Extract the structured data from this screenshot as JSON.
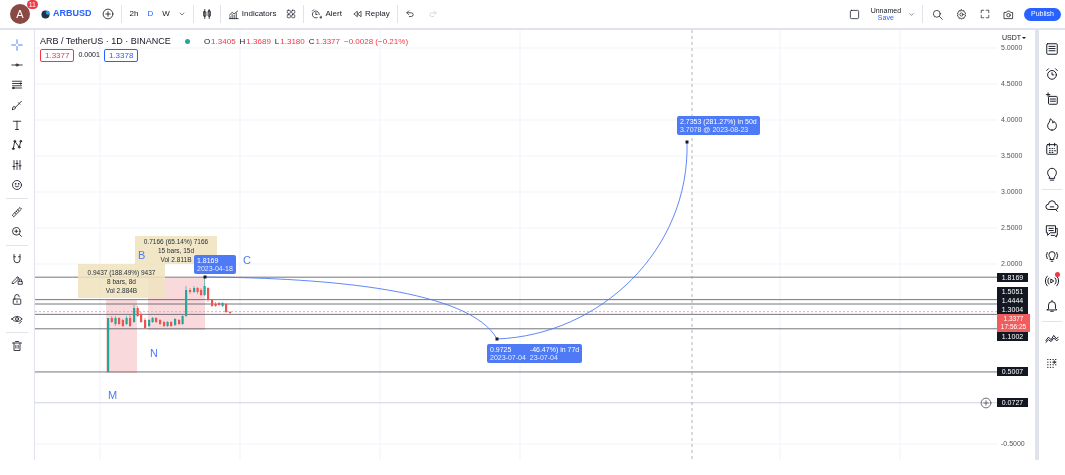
{
  "header": {
    "avatar": "A",
    "avatar_badge": "11",
    "symbol": "ARBUSD",
    "intervals": [
      {
        "label": "2h",
        "selected": false
      },
      {
        "label": "D",
        "selected": true
      },
      {
        "label": "W",
        "selected": false
      }
    ],
    "indicators": "Indicators",
    "alert": "Alert",
    "replay": "Replay",
    "layout_name": "Unnamed",
    "save": "Save",
    "publish": "Publish"
  },
  "left_toolbar": [
    {
      "selected": true
    },
    {
      "selected": false
    },
    {
      "selected": false
    },
    {
      "selected": false
    },
    {
      "selected": false
    },
    {
      "selected": false
    },
    {
      "selected": false
    },
    {
      "selected": false
    },
    {
      "selected": false
    },
    {
      "selected": false
    },
    {
      "selected": false
    },
    {
      "selected": false
    },
    {
      "selected": false
    },
    {
      "selected": false
    },
    {
      "selected": false
    }
  ],
  "legend": {
    "title": "ARB / TetherUS · 1D · BINANCE",
    "ohlc": [
      {
        "key": "O",
        "value": "1.3405"
      },
      {
        "key": "H",
        "value": "1.3689"
      },
      {
        "key": "L",
        "value": "1.3180"
      },
      {
        "key": "C",
        "value": "1.3377"
      }
    ],
    "change": "−0.0028 (−0.21%)",
    "sell": "1.3377",
    "spread": "0.0001",
    "buy": "1.3378"
  },
  "chart": {
    "range_boxes": [
      {
        "lines": [
          "0.9437 (188.49%) 9437",
          "8 bars, 8d",
          "Vol 2.884B"
        ]
      },
      {
        "lines": [
          "0.7166 (65.14%) 7166",
          "15 bars, 15d",
          "Vol 2.811B"
        ]
      }
    ],
    "points": [
      "B",
      "C",
      "N",
      "M"
    ],
    "callouts": [
      {
        "kind": "single",
        "title": "1.8169",
        "subtitle": "2023-04-18"
      },
      {
        "kind": "single",
        "title": "2.7353 (281.27%) in 50d",
        "subtitle": "3.7078 @ 2023-08-23"
      },
      {
        "kind": "split",
        "columns": [
          {
            "title": "0.9725",
            "subtitle": "2023-07-04"
          },
          {
            "title": "-46.47%) in 77d",
            "subtitle": "23-07-04"
          }
        ]
      }
    ]
  },
  "price_axis": {
    "currency": "USDT",
    "ticks": [
      "5.0000",
      "4.5000",
      "4.0000",
      "3.5000",
      "3.0000",
      "2.5000",
      "2.0000",
      "-0.5000"
    ],
    "levels": [
      {
        "price": "1.8169"
      },
      {
        "price": "1.5051"
      },
      {
        "price": "1.4444"
      },
      {
        "price": "1.3004"
      },
      {
        "price": "1.1002"
      },
      {
        "price": "0.5007"
      },
      {
        "price": "0.0727"
      }
    ],
    "current": {
      "price": "1.3377",
      "countdown": "17:56:25"
    }
  },
  "right_toolbar": [
    {
      "notification": false
    },
    {
      "notification": false
    },
    {
      "notification": false
    },
    {
      "notification": false
    },
    {
      "notification": false
    },
    {
      "notification": false
    },
    {
      "notification": false
    },
    {
      "notification": false
    },
    {
      "notification": false
    },
    {
      "notification": true
    },
    {
      "notification": false
    },
    {
      "notification": false
    },
    {
      "notification": false
    }
  ]
}
